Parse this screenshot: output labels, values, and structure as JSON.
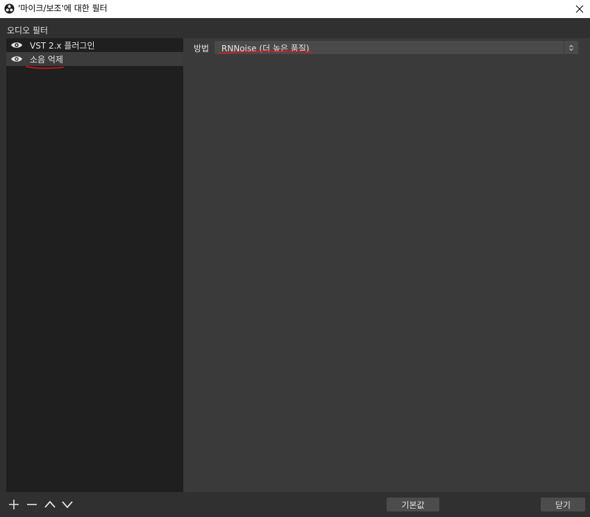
{
  "window": {
    "title": "'마이크/보조'에 대한 필터",
    "app_icon": "obs-logo-icon",
    "close_icon": "close-icon"
  },
  "audio_filters": {
    "label": "오디오 필터",
    "items": [
      {
        "label": "VST 2.x 플러그인",
        "icon": "eye-icon",
        "selected": false
      },
      {
        "label": "소음 억제",
        "icon": "eye-icon",
        "selected": true
      }
    ]
  },
  "properties": {
    "method_label": "방법",
    "method_value": "RNNoise (더 높은 품질)"
  },
  "toolbar": {
    "add_icon": "plus-icon",
    "remove_icon": "minus-icon",
    "move_up_icon": "chevron-up-icon",
    "move_down_icon": "chevron-down-icon"
  },
  "buttons": {
    "defaults_label": "기본값",
    "close_label": "닫기"
  },
  "colors": {
    "background": "#303030",
    "list_background": "#1f1f1f",
    "properties_background": "#3a3a3a",
    "annotation_red": "#e0161b"
  }
}
